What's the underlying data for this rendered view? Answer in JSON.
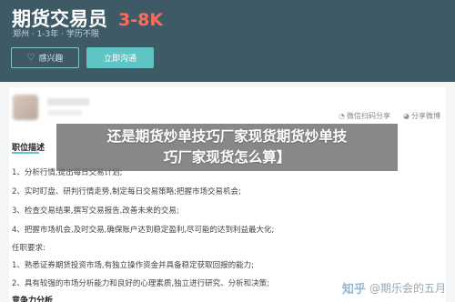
{
  "header": {
    "job_title": "期货交易员",
    "salary": "3-8K",
    "meta": "郑州 · 1-3年 · 学历不限",
    "interest_label": "感兴趣",
    "chat_label": "立即沟通"
  },
  "share": {
    "wechat_label": "微信扫码分享",
    "weibo_label": "分享微博"
  },
  "description": {
    "section_title": "职位描述",
    "duties": [
      "1、分析行情,提出每日交易计划;",
      "2、实时盯盘、研判行情走势,制定每日交易策略;把握市场交易机会;",
      "3、检查交易结果,撰写交易报告,改善未来的交易;",
      "4、把握市场机会,及时交易,确保账户达到稳定盈利,尽可能的达到利益最大化;"
    ],
    "requirements_title": "任职要求:",
    "requirements": [
      "1、熟悉证券期货投资市场,有独立操作资金并具备稳定获取回报的能力;",
      "2、具有较强的市场分析能力和良好的心理素质,独立进行研究、分析和决策;"
    ],
    "bottom_heading": "竞争力分析"
  },
  "overlay": {
    "line1": "还是期货炒单技巧厂家现货期货炒单技",
    "line2": "巧厂家现货怎么算】"
  },
  "watermark": {
    "brand": "知乎",
    "author": "@期乐会的五月"
  },
  "colors": {
    "header_bg": "#3d5a66",
    "salary": "#ff6b57",
    "accent": "#5fc4c4"
  }
}
